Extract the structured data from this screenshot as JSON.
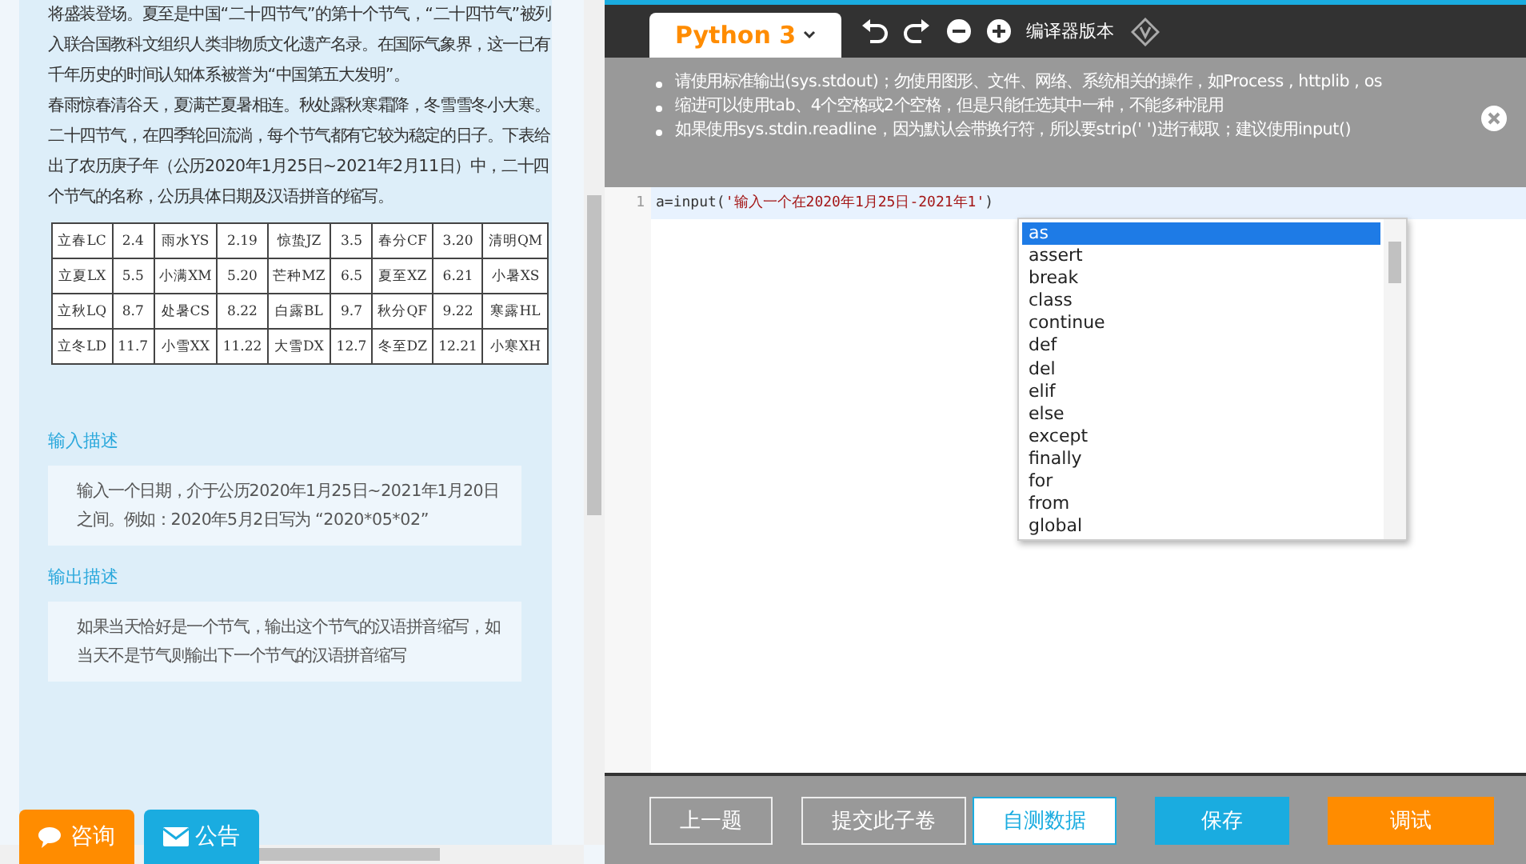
{
  "problem": {
    "paragraphs": [
      "将盛装登场。夏至是中国“二十四节气”的第十个节气，“二十四节气”被列入联合国教科文组织人类非物质文化遗产名录。在国际气象界，这一已有千年历史的时间认知体系被誉为“中国第五大发明”。",
      "春雨惊春清谷天，夏满芒夏暑相连。秋处露秋寒霜降，冬雪雪冬小大寒。二十四节气，在四季轮回流淌，每个节气都有它较为稳定的日子。下表给出了农历庚子年（公历2020年1月25日~2021年2月11日）中，二十四个节气的名称，公历具体日期及汉语拼音的缩写。"
    ],
    "table": [
      [
        "立春LC",
        "2.4",
        "雨水YS",
        "2.19",
        "惊蛰JZ",
        "3.5",
        "春分CF",
        "3.20",
        "清明QM"
      ],
      [
        "立夏LX",
        "5.5",
        "小满XM",
        "5.20",
        "芒种MZ",
        "6.5",
        "夏至XZ",
        "6.21",
        "小暑XS"
      ],
      [
        "立秋LQ",
        "8.7",
        "处暑CS",
        "8.22",
        "白露BL",
        "9.7",
        "秋分QF",
        "9.22",
        "寒露HL"
      ],
      [
        "立冬LD",
        "11.7",
        "小雪XX",
        "11.22",
        "大雪DX",
        "12.7",
        "冬至DZ",
        "12.21",
        "小寒XH"
      ]
    ],
    "sections": [
      {
        "heading": "输入描述",
        "body": "输入一个日期，介于公历2020年1月25日~2021年1月20日之间。例如：2020年5月2日写为 “2020*05*02”"
      },
      {
        "heading": "输出描述",
        "body": "如果当天恰好是一个节气，输出这个节气的汉语拼音缩写，如当天不是节气则输出下一个节气的汉语拼音缩写"
      }
    ]
  },
  "float_buttons": [
    {
      "label": "咨询",
      "kind": "chat"
    },
    {
      "label": "公告",
      "kind": "mail"
    }
  ],
  "editor": {
    "language": "Python 3",
    "version_label": "编译器版本",
    "notices": [
      "请使用标准输出(sys.stdout)；勿使用图形、文件、网络、系统相关的操作，如Process , httplib , os",
      "缩进可以使用tab、4个空格或2个空格，但是只能任选其中一种，不能多种混用",
      "如果使用sys.stdin.readline，因为默认会带换行符，所以要strip(' ')进行截取；建议使用input()"
    ],
    "lines": [
      {
        "number": "1",
        "code": "a=input(",
        "string": "'输入一个在2020年1月25日-2021年1'",
        "tail": ")"
      }
    ],
    "autocomplete": [
      {
        "label": "as",
        "selected": true
      },
      {
        "label": "assert",
        "selected": false
      },
      {
        "label": "break",
        "selected": false
      },
      {
        "label": "class",
        "selected": false
      },
      {
        "label": "continue",
        "selected": false
      },
      {
        "label": "def",
        "selected": false
      },
      {
        "label": "del",
        "selected": false
      },
      {
        "label": "elif",
        "selected": false
      },
      {
        "label": "else",
        "selected": false
      },
      {
        "label": "except",
        "selected": false
      },
      {
        "label": "finally",
        "selected": false
      },
      {
        "label": "for",
        "selected": false
      },
      {
        "label": "from",
        "selected": false
      },
      {
        "label": "global",
        "selected": false
      }
    ]
  },
  "buttons": [
    {
      "label": "上一题",
      "kind": "outline"
    },
    {
      "label": "提交此子卷",
      "kind": "outline"
    },
    {
      "label": "自测数据",
      "kind": "white"
    },
    {
      "label": "保存",
      "kind": "blue"
    },
    {
      "label": "调试",
      "kind": "orange"
    }
  ]
}
